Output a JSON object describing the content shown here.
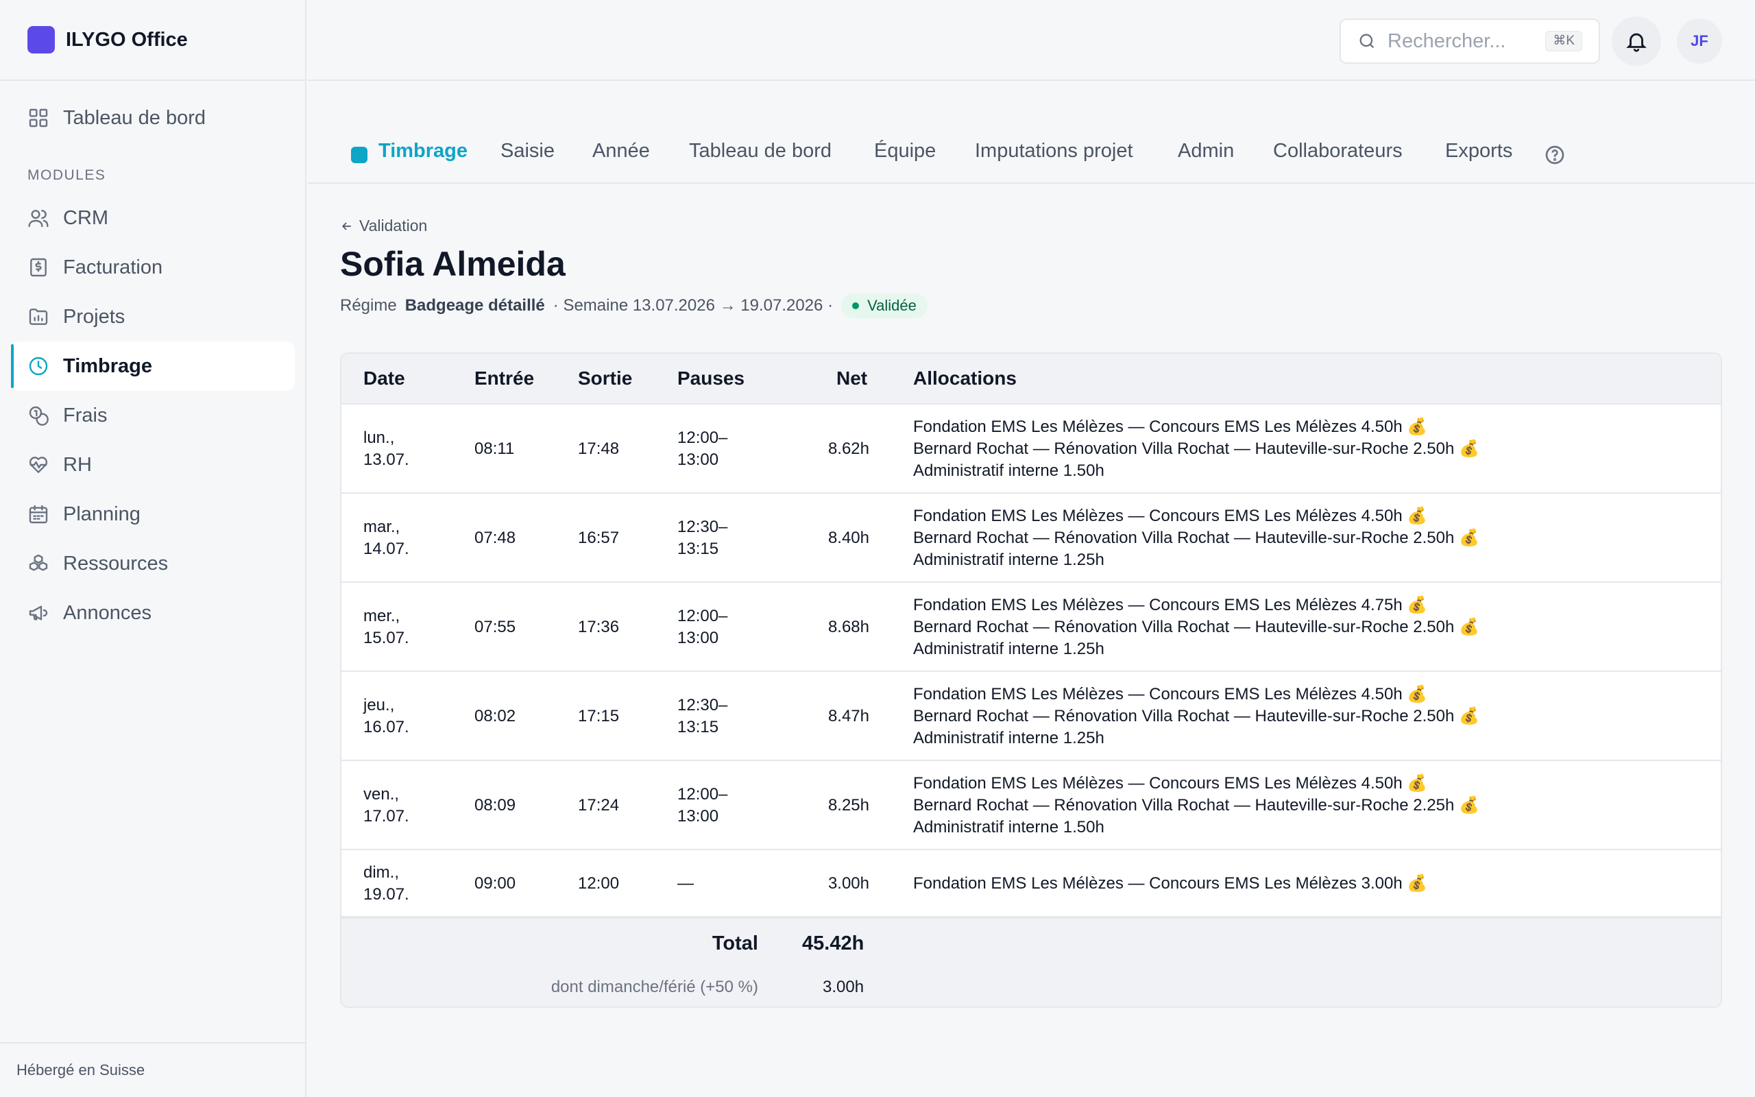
{
  "brand": {
    "name": "ILYGO Office",
    "color": "#5b4ae8"
  },
  "sidebar": {
    "dashboard": "Tableau de bord",
    "section_label": "MODULES",
    "items": [
      {
        "label": "CRM",
        "icon": "users-icon"
      },
      {
        "label": "Facturation",
        "icon": "invoice-icon"
      },
      {
        "label": "Projets",
        "icon": "folder-icon"
      },
      {
        "label": "Timbrage",
        "icon": "clock-icon",
        "active": true
      },
      {
        "label": "Frais",
        "icon": "coins-icon"
      },
      {
        "label": "RH",
        "icon": "heart-pulse-icon"
      },
      {
        "label": "Planning",
        "icon": "calendar-icon"
      },
      {
        "label": "Ressources",
        "icon": "boxes-icon"
      },
      {
        "label": "Annonces",
        "icon": "megaphone-icon"
      }
    ],
    "footer": "Hébergé en Suisse"
  },
  "topbar": {
    "search_placeholder": "Rechercher...",
    "search_shortcut": "⌘K",
    "avatar_initials": "JF"
  },
  "tabs": [
    "Timbrage",
    "Saisie",
    "Année",
    "Tableau de bord",
    "Équipe",
    "Imputations projet",
    "Admin",
    "Collaborateurs",
    "Exports"
  ],
  "accent_color": "#0ea5c6",
  "header": {
    "back_label": "Validation",
    "title": "Sofia Almeida",
    "regime_label": "Régime",
    "regime_value": "Badgeage détaillé",
    "week": "· Semaine 13.07.2026 → 19.07.2026 ·",
    "status": "Validée"
  },
  "table": {
    "columns": [
      "Date",
      "Entrée",
      "Sortie",
      "Pauses",
      "Net",
      "Allocations"
    ],
    "rows": [
      {
        "date1": "lun.,",
        "date2": "13.07.",
        "in": "08:11",
        "out": "17:48",
        "pause1": "12:00–",
        "pause2": "13:00",
        "net": "8.62h",
        "alloc": [
          "Fondation EMS Les Mélèzes — Concours EMS Les Mélèzes 4.50h 💰",
          "Bernard Rochat — Rénovation Villa Rochat — Hauteville-sur-Roche 2.50h 💰",
          "Administratif interne 1.50h"
        ]
      },
      {
        "date1": "mar.,",
        "date2": "14.07.",
        "in": "07:48",
        "out": "16:57",
        "pause1": "12:30–",
        "pause2": "13:15",
        "net": "8.40h",
        "alloc": [
          "Fondation EMS Les Mélèzes — Concours EMS Les Mélèzes 4.50h 💰",
          "Bernard Rochat — Rénovation Villa Rochat — Hauteville-sur-Roche 2.50h 💰",
          "Administratif interne 1.25h"
        ]
      },
      {
        "date1": "mer.,",
        "date2": "15.07.",
        "in": "07:55",
        "out": "17:36",
        "pause1": "12:00–",
        "pause2": "13:00",
        "net": "8.68h",
        "alloc": [
          "Fondation EMS Les Mélèzes — Concours EMS Les Mélèzes 4.75h 💰",
          "Bernard Rochat — Rénovation Villa Rochat — Hauteville-sur-Roche 2.50h 💰",
          "Administratif interne 1.25h"
        ]
      },
      {
        "date1": "jeu.,",
        "date2": "16.07.",
        "in": "08:02",
        "out": "17:15",
        "pause1": "12:30–",
        "pause2": "13:15",
        "net": "8.47h",
        "alloc": [
          "Fondation EMS Les Mélèzes — Concours EMS Les Mélèzes 4.50h 💰",
          "Bernard Rochat — Rénovation Villa Rochat — Hauteville-sur-Roche 2.50h 💰",
          "Administratif interne 1.25h"
        ]
      },
      {
        "date1": "ven.,",
        "date2": "17.07.",
        "in": "08:09",
        "out": "17:24",
        "pause1": "12:00–",
        "pause2": "13:00",
        "net": "8.25h",
        "alloc": [
          "Fondation EMS Les Mélèzes — Concours EMS Les Mélèzes 4.50h 💰",
          "Bernard Rochat — Rénovation Villa Rochat — Hauteville-sur-Roche 2.25h 💰",
          "Administratif interne 1.50h"
        ]
      },
      {
        "date1": "dim.,",
        "date2": "19.07.",
        "in": "09:00",
        "out": "12:00",
        "pause1": "—",
        "pause2": "",
        "net": "3.00h",
        "alloc": [
          "Fondation EMS Les Mélèzes — Concours EMS Les Mélèzes 3.00h 💰"
        ]
      }
    ],
    "total_label": "Total",
    "total_value": "45.42h",
    "sub_label": "dont dimanche/férié (+50 %)",
    "sub_value": "3.00h"
  }
}
